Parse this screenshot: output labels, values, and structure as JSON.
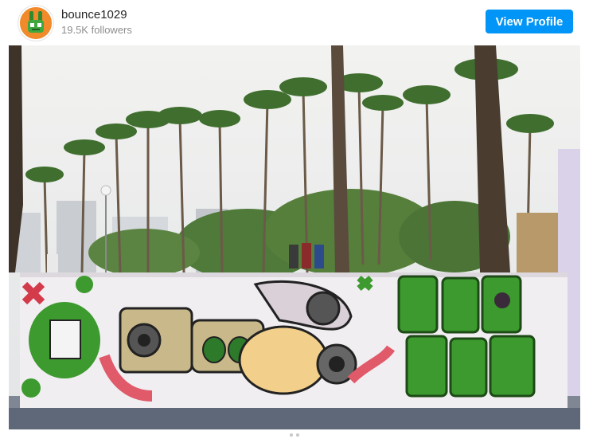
{
  "profile": {
    "username": "bounce1029",
    "followers": "19.5K followers",
    "avatar_icon": "bunny-mascot-icon"
  },
  "actions": {
    "view_profile_label": "View Profile"
  },
  "post": {
    "image_alt_icon": "graffiti-photo"
  },
  "colors": {
    "accent": "#0095f6",
    "username": "#262626",
    "secondary_text": "#8e8e8e"
  }
}
